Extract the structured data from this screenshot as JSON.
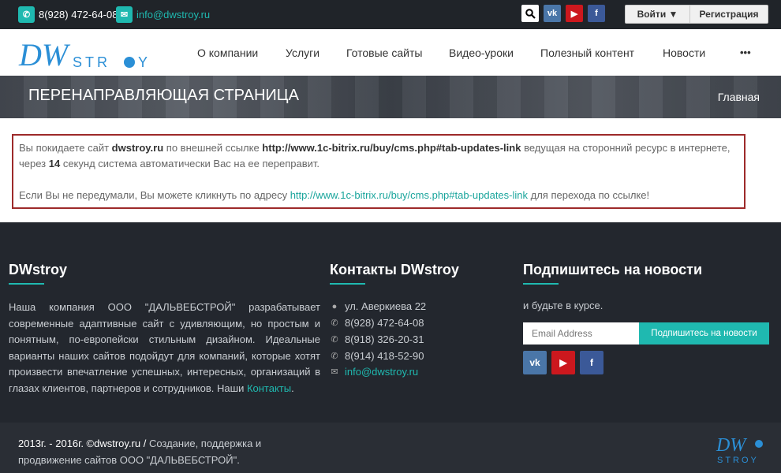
{
  "topbar": {
    "phone": "8(928) 472-64-08",
    "email": "info@dwstroy.ru",
    "login": "Войти",
    "register": "Регистрация"
  },
  "nav": {
    "items": [
      "О компании",
      "Услуги",
      "Готовые сайты",
      "Видео-уроки",
      "Полезный контент",
      "Новости"
    ],
    "more": "•••"
  },
  "banner": {
    "title": "ПЕРЕНАПРАВЛЯЮЩАЯ СТРАНИЦА",
    "breadcrumb": "Главная"
  },
  "redirect": {
    "p1_a": "Вы покидаете сайт ",
    "site": "dwstroy.ru",
    "p1_b": " по внешней ссылке ",
    "url": "http://www.1c-bitrix.ru/buy/cms.php#tab-updates-link",
    "p1_c": " ведущая на сторонний ресурс в интернете, через ",
    "seconds": "14",
    "p1_d": " секунд система автоматически Вас на ее переправит.",
    "p2_a": "Если Вы не передумали, Вы можете кликнуть по адресу ",
    "p2_link": "http://www.1c-bitrix.ru/buy/cms.php#tab-updates-link",
    "p2_b": " для перехода по ссылке!"
  },
  "footer": {
    "about_title": "DWstroy",
    "about_text": "Наша компания ООО \"ДАЛЬВЕБСТРОЙ\" разрабатывает современные адаптивные сайт с удивляющим, но простым и понятным, по-европейски стильным дизайном. Идеальные варианты наших сайтов подойдут для компаний, которые хотят произвести впечатление успешных, интересных, организаций в глазах клиентов, партнеров и сотрудников. Наши ",
    "about_link": "Контакты",
    "about_end": ".",
    "contacts_title": "Контакты DWstroy",
    "contacts": [
      "ул. Аверкиева 22",
      "8(928) 472-64-08",
      "8(918) 326-20-31",
      "8(914) 418-52-90",
      "info@dwstroy.ru"
    ],
    "subscribe_title": "Подпишитесь на новости",
    "subscribe_text": "и будьте в курсе.",
    "email_placeholder": "Email Address",
    "subscribe_button": "Подпишитесь на новости"
  },
  "bottom": {
    "copy_a": "2013г. - 2016г. ©dwstroy.ru / ",
    "copy_b": "Создание, поддержка и продвижение сайтов ООО \"ДАЛЬВЕБСТРОЙ\"."
  },
  "logo": {
    "main": "DW",
    "sub": "STROY"
  },
  "colors": {
    "accent": "#1fb9b0",
    "alert_border": "#9d2a2a",
    "vk": "#4a76a8",
    "youtube": "#cc181e",
    "facebook": "#3b5998"
  },
  "icons": [
    "phone-icon",
    "mail-icon",
    "search-icon",
    "vk-icon",
    "youtube-icon",
    "facebook-icon",
    "map-marker-icon"
  ]
}
